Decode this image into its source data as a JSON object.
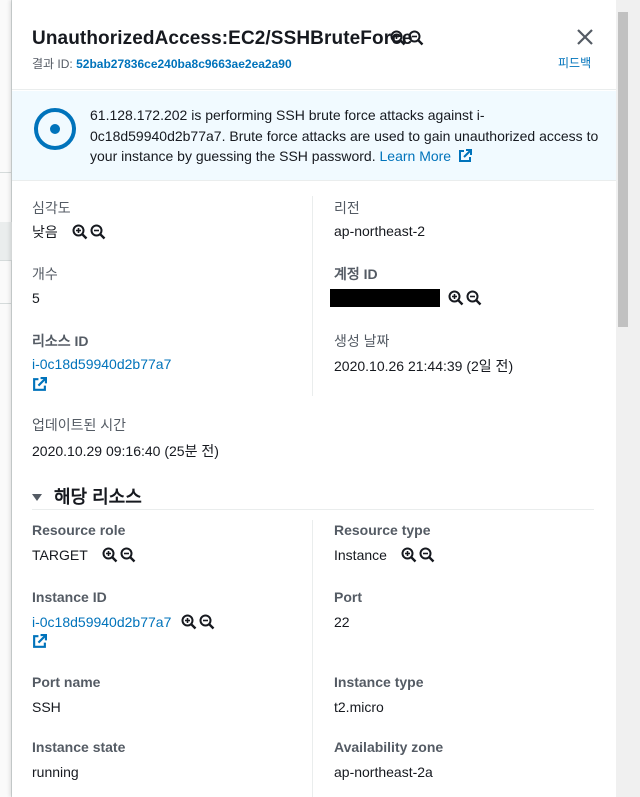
{
  "finding": {
    "title": "UnauthorizedAccess:EC2/SSHBruteForce",
    "id_label": "결과 ID:",
    "id_value": "52bab27836ce240ba8c9663ae2ea2a90",
    "feedback": "피드백"
  },
  "info": {
    "text": "61.128.172.202 is performing SSH brute force attacks against i-0c18d59940d2b77a7. Brute force attacks are used to gain unauthorized access to your instance by guessing the SSH password.",
    "link": "Learn More"
  },
  "fields": {
    "severity_label": "심각도",
    "severity_value": "낮음",
    "region_label": "리전",
    "region_value": "ap-northeast-2",
    "count_label": "개수",
    "count_value": "5",
    "account_label": "계정 ID",
    "resource_label": "리소스 ID",
    "resource_value": "i-0c18d59940d2b77a7",
    "created_label": "생성 날짜",
    "created_value": "2020.10.26 21:44:39 (2일 전)",
    "updated_label": "업데이트된 시간",
    "updated_value": "2020.10.29 09:16:40 (25분 전)"
  },
  "resources_section": {
    "title": "해당 리소스",
    "resource_role_label": "Resource role",
    "resource_role_value": "TARGET",
    "resource_type_label": "Resource type",
    "resource_type_value": "Instance",
    "instance_id_label": "Instance ID",
    "instance_id_value": "i-0c18d59940d2b77a7",
    "port_label": "Port",
    "port_value": "22",
    "port_name_label": "Port name",
    "port_name_value": "SSH",
    "instance_type_label": "Instance type",
    "instance_type_value": "t2.micro",
    "instance_state_label": "Instance state",
    "instance_state_value": "running",
    "az_label": "Availability zone",
    "az_value": "ap-northeast-2a"
  },
  "colors": {
    "link": "#0073bb",
    "info_bg": "#f1faff",
    "text": "#16191f",
    "muted": "#545b64"
  },
  "icons": [
    "zoom-in-icon",
    "zoom-out-icon",
    "close-icon",
    "info-icon",
    "external-link-icon",
    "caret-down-icon"
  ]
}
